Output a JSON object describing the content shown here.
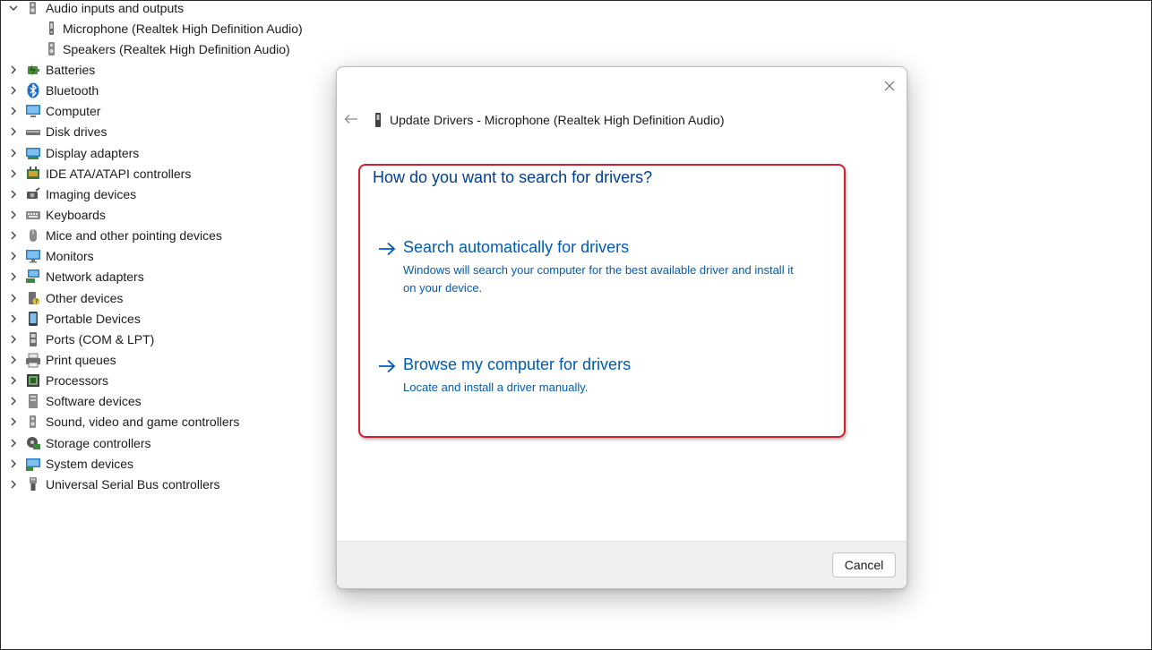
{
  "tree": {
    "expanded_item": {
      "label": "Audio inputs and outputs",
      "icon": "speaker-icon",
      "children": [
        {
          "label": "Microphone (Realtek High Definition Audio)",
          "icon": "microphone-device-icon"
        },
        {
          "label": "Speakers (Realtek High Definition Audio)",
          "icon": "speaker-device-icon"
        }
      ]
    },
    "items": [
      {
        "label": "Batteries",
        "icon": "battery-icon"
      },
      {
        "label": "Bluetooth",
        "icon": "bluetooth-icon"
      },
      {
        "label": "Computer",
        "icon": "computer-icon"
      },
      {
        "label": "Disk drives",
        "icon": "disk-drive-icon"
      },
      {
        "label": "Display adapters",
        "icon": "display-adapter-icon"
      },
      {
        "label": "IDE ATA/ATAPI controllers",
        "icon": "ide-controller-icon"
      },
      {
        "label": "Imaging devices",
        "icon": "camera-icon"
      },
      {
        "label": "Keyboards",
        "icon": "keyboard-icon"
      },
      {
        "label": "Mice and other pointing devices",
        "icon": "mouse-icon"
      },
      {
        "label": "Monitors",
        "icon": "monitor-icon"
      },
      {
        "label": "Network adapters",
        "icon": "network-adapter-icon"
      },
      {
        "label": "Other devices",
        "icon": "unknown-device-icon"
      },
      {
        "label": "Portable Devices",
        "icon": "portable-device-icon"
      },
      {
        "label": "Ports (COM & LPT)",
        "icon": "port-icon"
      },
      {
        "label": "Print queues",
        "icon": "printer-icon"
      },
      {
        "label": "Processors",
        "icon": "processor-icon"
      },
      {
        "label": "Software devices",
        "icon": "software-device-icon"
      },
      {
        "label": "Sound, video and game controllers",
        "icon": "sound-controller-icon"
      },
      {
        "label": "Storage controllers",
        "icon": "storage-controller-icon"
      },
      {
        "label": "System devices",
        "icon": "system-device-icon"
      },
      {
        "label": "Universal Serial Bus controllers",
        "icon": "usb-icon"
      }
    ]
  },
  "dialog": {
    "title": "Update Drivers - Microphone (Realtek High Definition Audio)",
    "question": "How do you want to search for drivers?",
    "options": [
      {
        "title": "Search automatically for drivers",
        "description": "Windows will search your computer for the best available driver and install it on your device."
      },
      {
        "title": "Browse my computer for drivers",
        "description": "Locate and install a driver manually."
      }
    ],
    "cancel_label": "Cancel"
  },
  "colors": {
    "link": "#005bb5",
    "heading": "#003e92",
    "highlight_border": "#cf2030",
    "footer_bg": "#f0f0f0"
  }
}
